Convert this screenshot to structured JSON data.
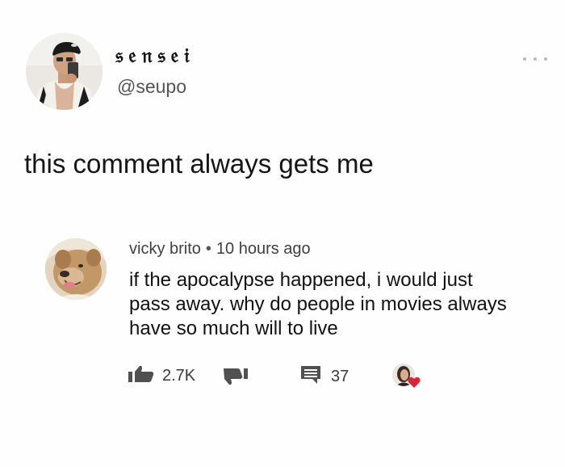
{
  "tweet": {
    "display_name": "𝔰𝔢𝔫𝔰𝔢𝔦",
    "handle": "@seupo",
    "text": "this comment always gets me"
  },
  "comment": {
    "author": "vicky brito",
    "separator": "•",
    "time": "10 hours ago",
    "body_lines": [
      "if the apocalypse happened, i would just",
      "pass away. why do people in movies always",
      "have so much will to live"
    ],
    "likes": "2.7K",
    "replies": "37"
  },
  "icons": {
    "more": "more-options-icon",
    "like": "thumbs-up-icon",
    "dislike": "thumbs-down-icon",
    "reply": "comment-icon",
    "heart": "heart-icon"
  },
  "colors": {
    "heart": "#d8263a",
    "icon_gray": "#505050"
  }
}
